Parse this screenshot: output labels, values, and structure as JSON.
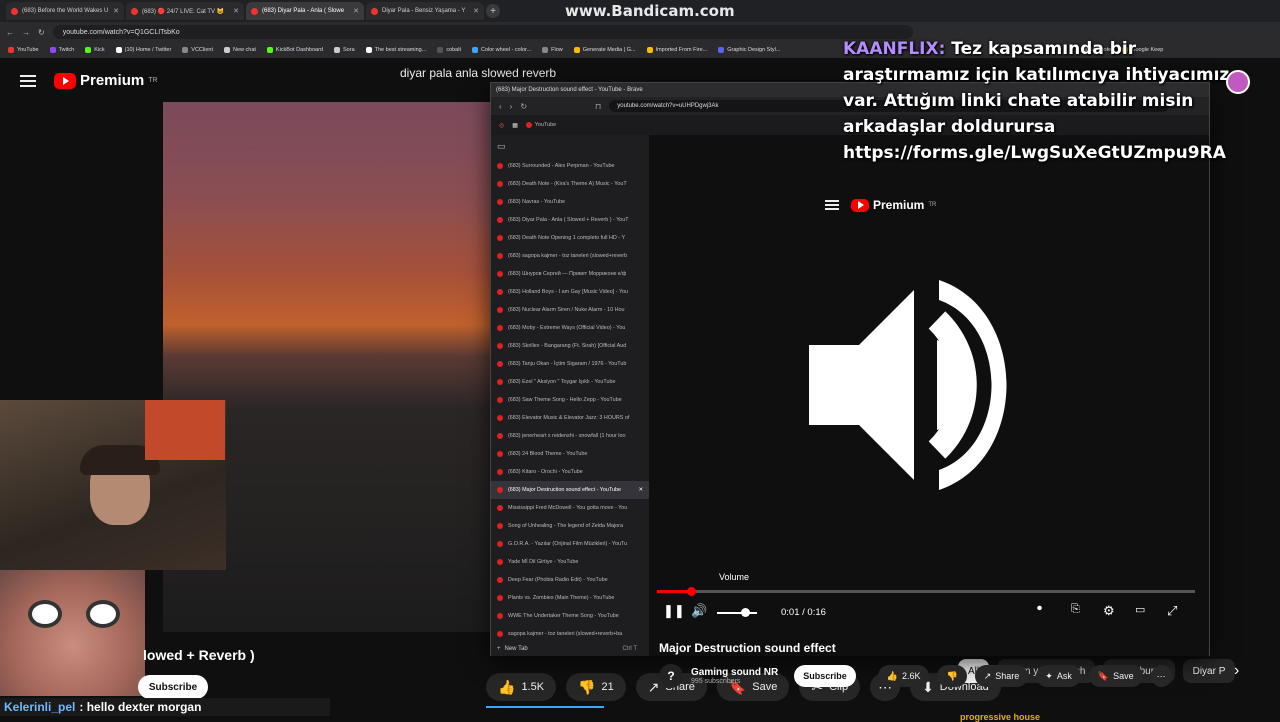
{
  "tabs": [
    {
      "label": "(683) Before the World Wakes U"
    },
    {
      "label": "(683) 🔴 24/7 LIVE: Cat TV 😺"
    },
    {
      "label": "(683) Diyar Pala - Anla ( Slowe"
    },
    {
      "label": "Diyar Pala - Bensiz Yaşama - Y"
    }
  ],
  "watermark": "www.Bandicam.com",
  "main_url": "youtube.com/watch?v=Q1GCLITsbKo",
  "bookmarks": [
    "YouTube",
    "Twitch",
    "Kick",
    "(10) Home / Twitter",
    "VCClient",
    "New chat",
    "KickBot Dashboard",
    "Sora",
    "The best streaming...",
    "cobalt",
    "Color wheel - color...",
    "Flow",
    "Generate Media | G...",
    "Imported From Fire...",
    "Graphic Design Styl...",
    "Milanote",
    "Google Keep"
  ],
  "bg": {
    "logo": "Premium",
    "logo_sup": "TR",
    "search_text": "diyar pala anla slowed reverb",
    "video_title_partial": "lowed + Reverb )",
    "subscribe": "Subscribe",
    "actions": [
      {
        "icon": "👍",
        "label": "1.5K",
        "name": "like-button"
      },
      {
        "icon": "👎",
        "label": "21",
        "name": "dislike-button"
      },
      {
        "icon": "↗",
        "label": "Share",
        "name": "share-button"
      },
      {
        "icon": "🔖",
        "label": "Save",
        "name": "save-button"
      },
      {
        "icon": "✂",
        "label": "Clip",
        "name": "clip-button"
      },
      {
        "icon": "⋯",
        "label": "",
        "name": "more-button"
      },
      {
        "icon": "⬇",
        "label": "Download",
        "name": "download-button"
      }
    ],
    "chips": [
      "All",
      "From your search",
      "From burak",
      "Diyar P"
    ],
    "progressive": "progressive house"
  },
  "chat": {
    "user": "Kelerinli_pel",
    "message": ": hello dexter morgan"
  },
  "stream_chat": {
    "user": "KAANFLIX:",
    "line1": " Tez kapsamında bir araştırmamız için katılımcıya ihtiyacımız var. Attığım linki chate atabilir misin arkadaşlar doldurursa",
    "link": "https://forms.gle/LwgSuXeGtUZmpu9RA"
  },
  "overlay": {
    "window_title": "(683) Major Destruction sound effect - YouTube - Brave",
    "url": "youtube.com/watch?v=uUHPDgwj3Ak",
    "pinned_tab": "YouTube",
    "logo": "Premium",
    "logo_sup": "TR",
    "sidebar": [
      "(683) Surrounded - Alex Perpman - YouTube",
      "(683) Death Note - (Kira's Theme A) Music - YouT",
      "(683) Navras - YouTube",
      "(683) Diyar Pala - Anla ( Slowed + Reverb ) - YouT",
      "(683) Death Note Opening 1 completo full HD - Y",
      "(683) sagopa kajmer - toz taneleri (slowed+reverb",
      "(683) Шнуров Сергей — Привет Морриконе к/ф",
      "(683) Holland Boys - I am Gay [Music Video] - You",
      "(683) Nuclear Alarm Siren / Nuke Alarm - 10 Hou",
      "(683) Moby - Extreme Ways (Official Video) - You",
      "(683) Skrillex - Bangarang (Ft. Sirah) [Official Aud",
      "(683) Tanju Okan - İçtim Sigaram / 1976 - YouTub",
      "(683) Ezel \" Aksiyon \" Toygar Işıklı - YouTube",
      "(683) Saw Theme Song - Hello Zepp - YouTube",
      "(683) Elevator Music & Elevator Jazz: 3 HOURS of",
      "(683) jenerheart x reidenshi - snowfall (1 hour loo",
      "(683) 24 Blood Theme - YouTube",
      "(683) Kitaro - Orochi - YouTube",
      "(683) Major Destruction sound effect - YouTube",
      "Mississippi Fred McDowell - You gotta move - You",
      "Song of Unhealing - The legend of Zelda Majora",
      "G.O.R.A. - Yazılar (Orijinal Film Müzikleri) - YouTu",
      "Yade Mİ Dil Girtiye - YouTube",
      "Deep Fear (Phobia Radio Edit) - YouTube",
      "Plants vs. Zombies (Main Theme) - YouTube",
      "WWE The Undertaker Theme Song - YouTube",
      "sagopa kajmer - toz taneleri (slowed+reverb+ba"
    ],
    "active_index": 18,
    "new_tab": "New Tab",
    "new_tab_shortcut": "Ctrl T",
    "volume_label": "Volume",
    "time": "0:01 / 0:16",
    "progress": 0.0625,
    "volume_level": 0.6,
    "video_title": "Major Destruction sound effect",
    "channel": "Gaming sound NR",
    "subscribers": "995 subscribers",
    "subscribe": "Subscribe",
    "likes": "2.6K",
    "share": "Share",
    "ask": "Ask",
    "save": "Save"
  }
}
